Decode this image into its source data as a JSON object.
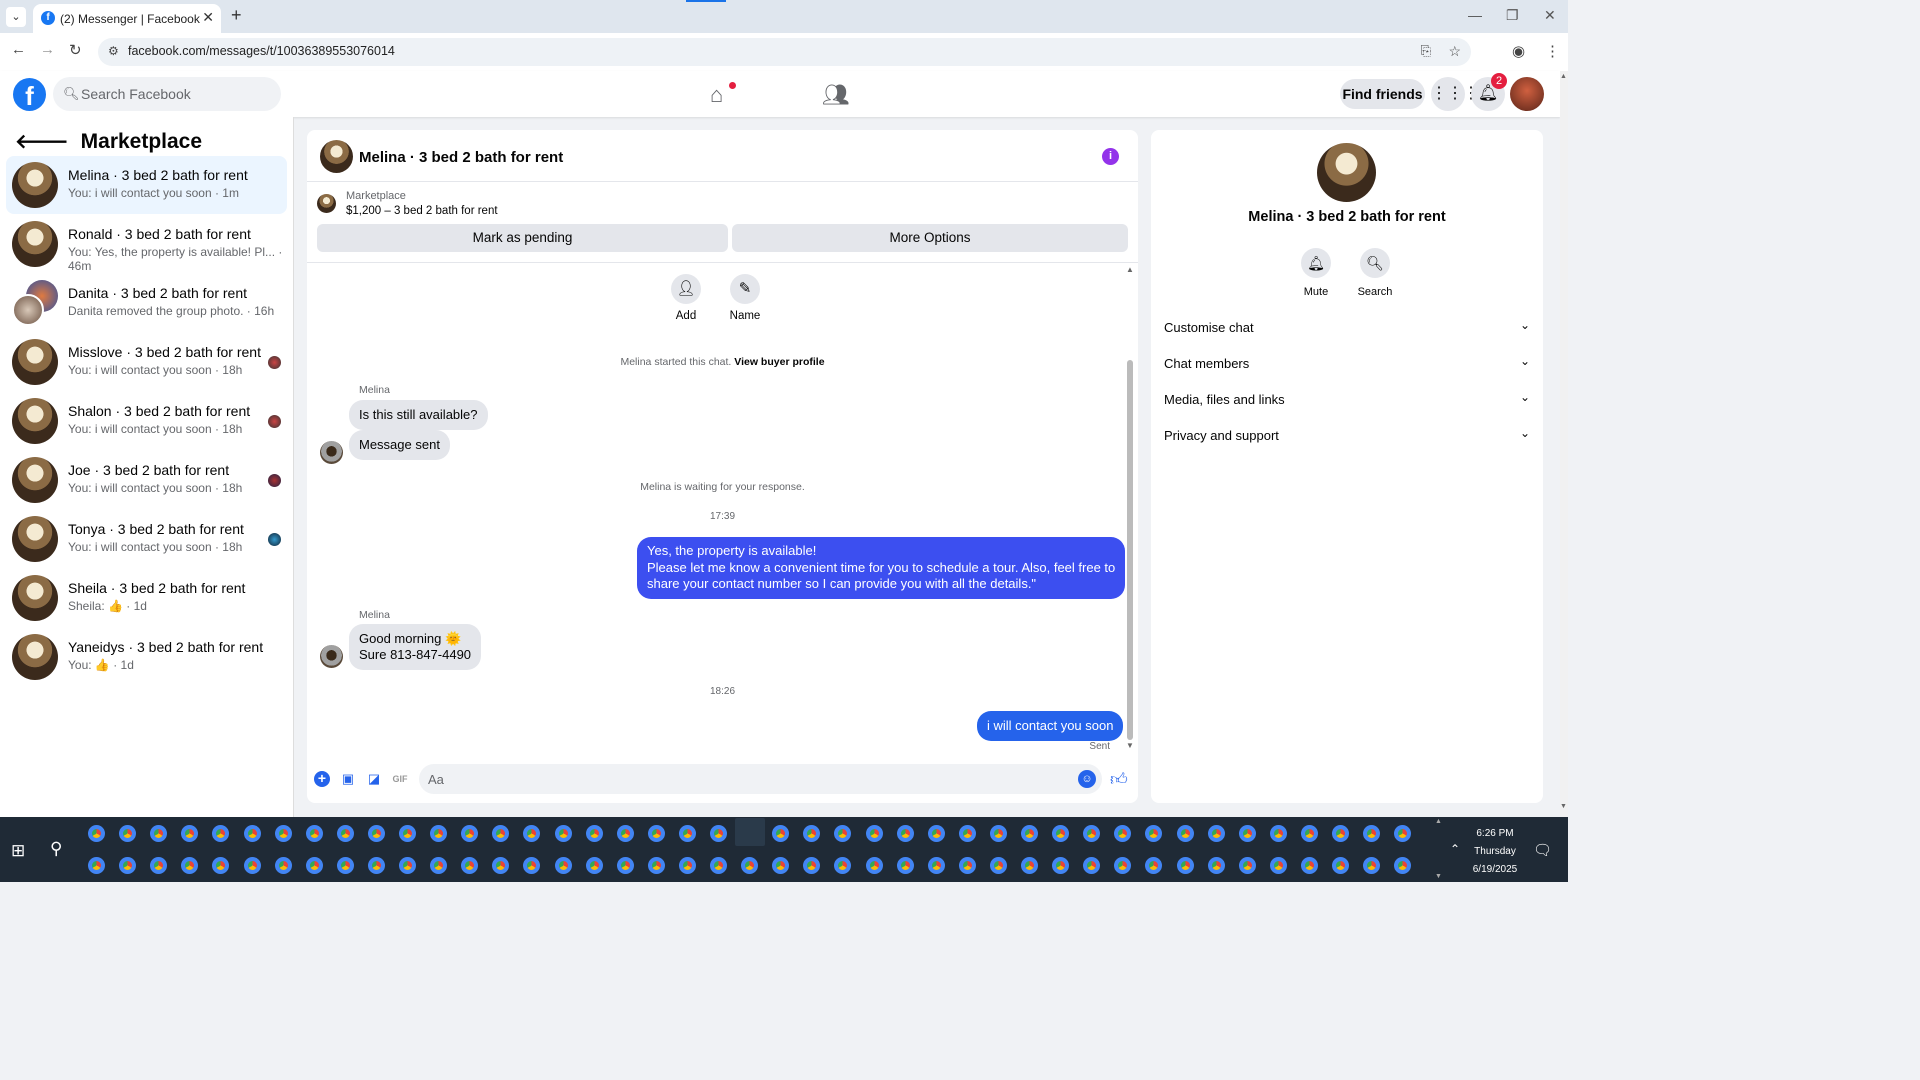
{
  "browser": {
    "tab_title": "(2) Messenger | Facebook",
    "url": "facebook.com/messages/t/10036389553076014",
    "new_tab": "+",
    "close_tab": "✕"
  },
  "fb_header": {
    "logo": "f",
    "search_placeholder": "Search Facebook",
    "find_friends": "Find friends",
    "notification_count": "2"
  },
  "sidebar": {
    "title": "Marketplace",
    "conversations": [
      {
        "name": "Melina · 3 bed 2 bath for rent",
        "preview": "You: i will contact you soon · 1m",
        "active": true
      },
      {
        "name": "Ronald · 3 bed 2 bath for rent",
        "preview": "You: Yes, the property is available! Pl... · 46m"
      },
      {
        "name": "Danita · 3 bed 2 bath for rent",
        "preview": "Danita removed the group photo. · 16h"
      },
      {
        "name": "Misslove · 3 bed 2 bath for rent",
        "preview": "You: i will contact you soon · 18h"
      },
      {
        "name": "Shalon · 3 bed 2 bath for rent",
        "preview": "You: i will contact you soon · 18h"
      },
      {
        "name": "Joe · 3 bed 2 bath for rent",
        "preview": "You: i will contact you soon · 18h"
      },
      {
        "name": "Tonya · 3 bed 2 bath for rent",
        "preview": "You: i will contact you soon · 18h"
      },
      {
        "name": "Sheila · 3 bed 2 bath for rent",
        "preview": "Sheila: 👍 · 1d"
      },
      {
        "name": "Yaneidys · 3 bed 2 bath for rent",
        "preview": "You: 👍 · 1d"
      }
    ]
  },
  "chat": {
    "title": "Melina · 3 bed 2 bath for rent",
    "info_icon": "i",
    "marketplace_label": "Marketplace",
    "listing": "$1,200 – 3 bed 2 bath for rent",
    "mark_pending": "Mark as pending",
    "more_options": "More Options",
    "add_label": "Add",
    "name_label": "Name",
    "started_text": "Melina started this chat.",
    "view_profile": "View buyer profile",
    "sender1": "Melina",
    "msg1": "Is this still available?",
    "msg2": "Message sent",
    "waiting": "Melina is waiting for your response.",
    "time1": "17:39",
    "out1_l1": "Yes, the property is available!",
    "out1_l2": "Please let me know a convenient time for you to schedule a tour. Also, feel free to",
    "out1_l3": "share your contact number so I can provide you with all the details.\"",
    "sender2": "Melina",
    "msg3_l1": "Good morning 🌞",
    "msg3_l2": "Sure 813-847-4490",
    "time2": "18:26",
    "out2": "i will contact you soon",
    "sent_status": "Sent",
    "composer_placeholder": "Aa"
  },
  "details": {
    "title": "Melina · 3 bed 2 bath for rent",
    "mute": "Mute",
    "search": "Search",
    "sections": [
      "Customise chat",
      "Chat members",
      "Media, files and links",
      "Privacy and support"
    ]
  },
  "taskbar": {
    "time": "6:26 PM",
    "day": "Thursday",
    "date": "6/19/2025"
  },
  "colors": {
    "fb_blue": "#1877f2",
    "outgoing_bubble": "#3c4ff0",
    "incoming_bubble": "#e4e6eb",
    "active_conv": "#ebf5ff"
  }
}
